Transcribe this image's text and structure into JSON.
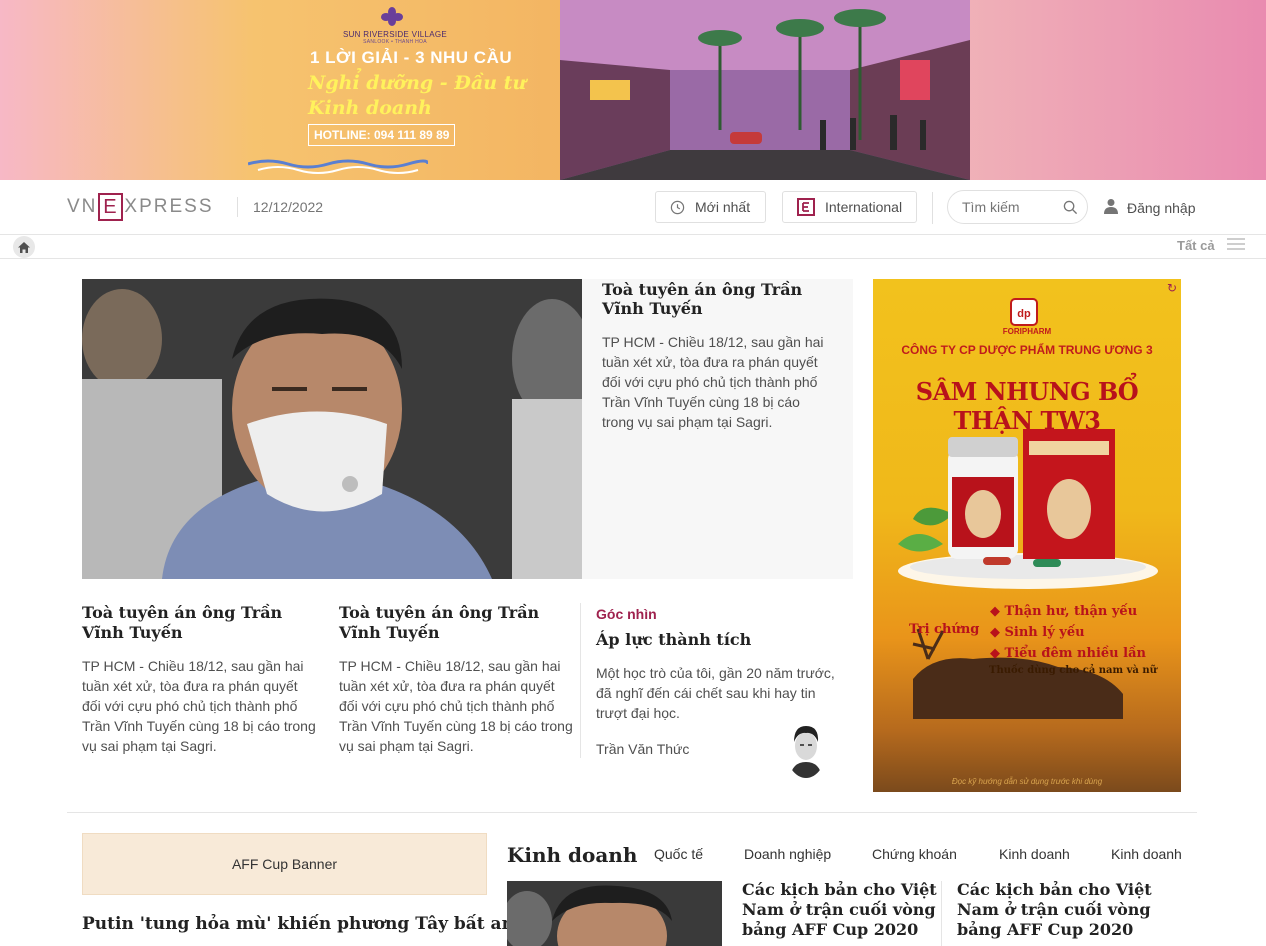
{
  "top_ad": {
    "brand": "SUN RIVERSIDE VILLAGE",
    "brand_sub": "SANLOOK • THANH HOA",
    "tagline": "1 LỜI GIẢI - 3 NHU CẦU",
    "line1": "Nghỉ dưỡng - Đầu tư",
    "line2": "Kinh doanh",
    "hotline": "HOTLINE: 094 111 89 89"
  },
  "header": {
    "logo_left": "VN",
    "logo_e": "E",
    "logo_right": "XPRESS",
    "date": "12/12/2022",
    "latest_label": "Mới nhất",
    "international_label": "International",
    "search_placeholder": "Tìm kiếm",
    "login_label": "Đăng nhập"
  },
  "nav": {
    "all_label": "Tất cả"
  },
  "featured": {
    "title": "Toà tuyên án ông Trần Vĩnh Tuyến",
    "desc": "TP HCM - Chiều 18/12, sau gần hai tuần xét xử, tòa đưa ra phán quyết đối với cựu phó chủ tịch thành phố Trần Vĩnh Tuyến cùng 18 bị cáo trong vụ sai phạm tại Sagri."
  },
  "sub_news": [
    {
      "title": "Toà tuyên án ông Trần Vĩnh Tuyến",
      "desc": "TP HCM - Chiều 18/12, sau gần hai tuần xét xử, tòa đưa ra phán quyết đối với cựu phó chủ tịch thành phố Trần Vĩnh Tuyến cùng 18 bị cáo trong vụ sai phạm tại Sagri."
    },
    {
      "title": "Toà tuyên án ông Trần Vĩnh Tuyến",
      "desc": "TP HCM - Chiều 18/12, sau gần hai tuần xét xử, tòa đưa ra phán quyết đối với cựu phó chủ tịch thành phố Trần Vĩnh Tuyến cùng 18 bị cáo trong vụ sai phạm tại Sagri."
    }
  ],
  "opinion": {
    "category": "Góc nhìn",
    "title": "Áp lực thành tích",
    "desc": "Một học trò của tôi, gần 20 năm trước, đã nghĩ đến cái chết sau khi hay tin trượt đại học.",
    "author": "Trần Văn Thức"
  },
  "side_ad": {
    "company_name": "FORIPHARM",
    "company": "CÔNG TY CP DƯỢC PHẨM TRUNG ƯƠNG 3",
    "product": "SÂM NHUNG BỔ THẬN TW3",
    "tri_chung": "Trị chứng",
    "items": [
      "Thận hư, thận yếu",
      "Sinh lý yếu",
      "Tiểu đêm nhiều lần"
    ],
    "note": "Thuốc dùng cho cả nam và nữ",
    "footer": "Đọc kỹ hướng dẫn sử dụng trước khi dùng"
  },
  "bottom": {
    "aff_banner": "AFF Cup Banner",
    "putin_title": "Putin 'tung hỏa mù' khiến phương Tây bất an",
    "section_title": "Kinh doanh",
    "sub_categories": [
      "Quốc tế",
      "Doanh nghiệp",
      "Chứng khoán",
      "Kinh doanh",
      "Kinh doanh"
    ],
    "kd_news": [
      "Các kịch bản cho Việt Nam ở trận cuối vòng bảng AFF Cup 2020",
      "Các kịch bản cho Việt Nam ở trận cuối vòng bảng AFF Cup 2020"
    ]
  },
  "colors": {
    "brand": "#9f224e",
    "text": "#222222",
    "muted": "#757575"
  }
}
